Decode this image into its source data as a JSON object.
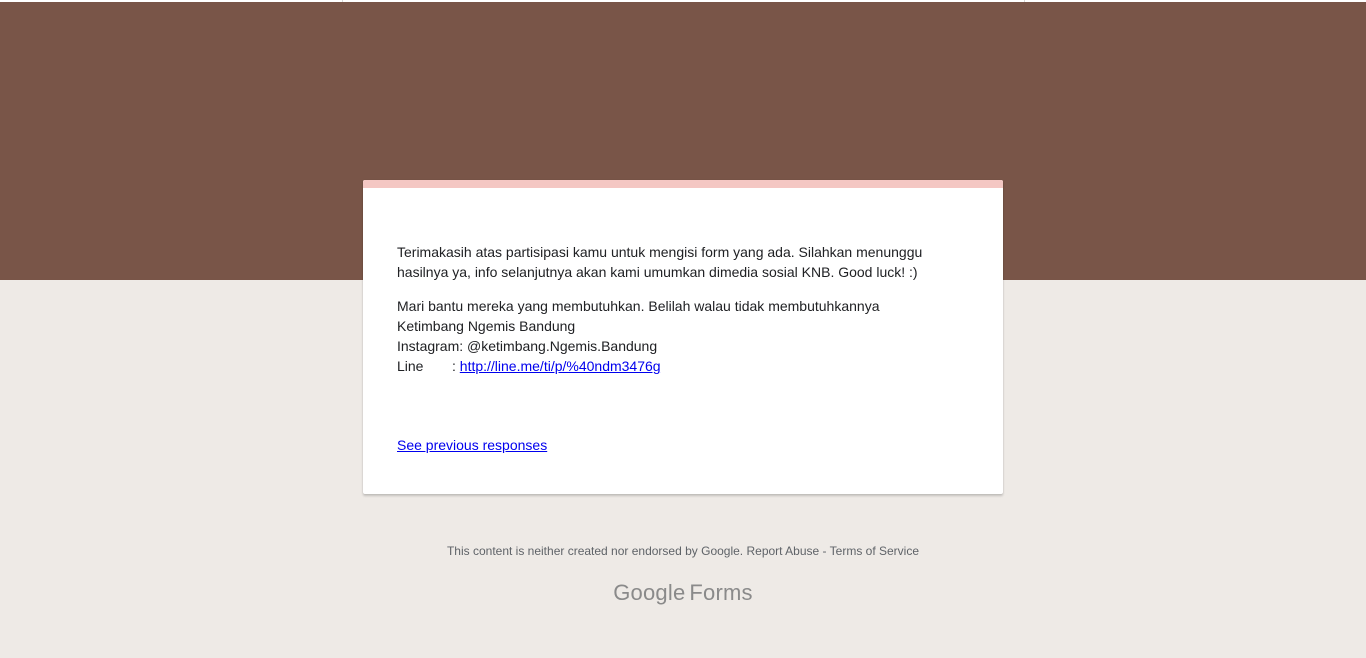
{
  "confirmation": {
    "paragraph1": "Terimakasih atas partisipasi kamu untuk mengisi form yang ada. Silahkan menunggu hasilnya ya, info selanjutnya akan kami umumkan dimedia sosial KNB. Good luck! :)",
    "paragraph2_line1": "Mari bantu mereka yang membutuhkan. Belilah walau tidak membutuhkannya",
    "paragraph2_line2": "Ketimbang Ngemis Bandung",
    "instagram_line": "Instagram: @ketimbang.Ngemis.Bandung",
    "line_label": "Line",
    "line_separator": ": ",
    "line_link": "http://line.me/ti/p/%40ndm3476g"
  },
  "actions": {
    "see_previous": "See previous responses"
  },
  "footer": {
    "disclaimer": "This content is neither created nor endorsed by Google.",
    "report_abuse": "Report Abuse",
    "separator": " - ",
    "terms": "Terms of Service"
  },
  "branding": {
    "google": "Google",
    "forms": "Forms"
  },
  "colors": {
    "header_band": "#795548",
    "background": "#eeeae6",
    "card_accent": "#f4c7c3",
    "link": "#0000ee"
  }
}
